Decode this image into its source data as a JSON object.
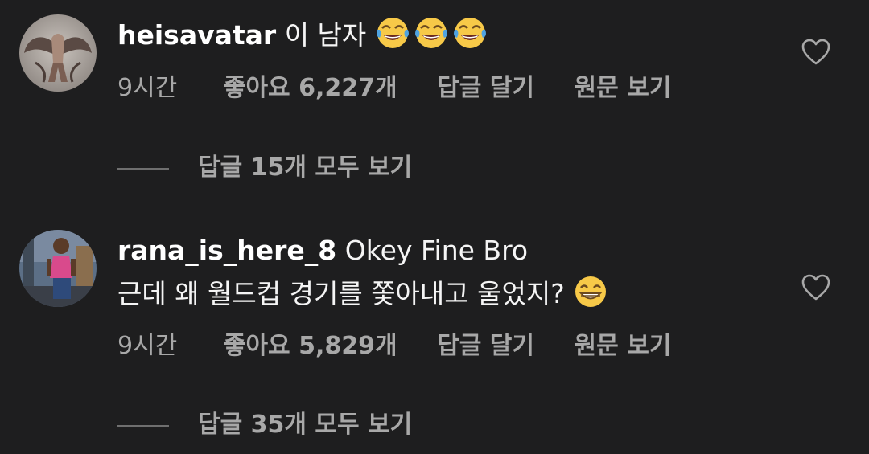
{
  "comments": [
    {
      "username": "heisavatar",
      "text": "이 남자",
      "emojis": [
        "face-with-tears-of-joy-icon",
        "face-with-tears-of-joy-icon",
        "face-with-tears-of-joy-icon"
      ],
      "time": "9시간",
      "likes": "좋아요 6,227개",
      "reply": "답글 달기",
      "translate": "원문 보기",
      "view_replies": "답글 15개 모두 보기"
    },
    {
      "username": "rana_is_here_8",
      "text_line1": "Okey Fine Bro",
      "text_line2": "근데 왜 월드컵 경기를 쫓아내고 울었지?",
      "emojis": [
        "grinning-face-with-smiling-eyes-icon"
      ],
      "time": "9시간",
      "likes": "좋아요 5,829개",
      "reply": "답글 달기",
      "translate": "원문 보기",
      "view_replies": "답글 35개 모두 보기"
    }
  ],
  "colors": {
    "background": "#1e1e1f",
    "text": "#f5f5f5",
    "muted": "#a8a8a8"
  }
}
